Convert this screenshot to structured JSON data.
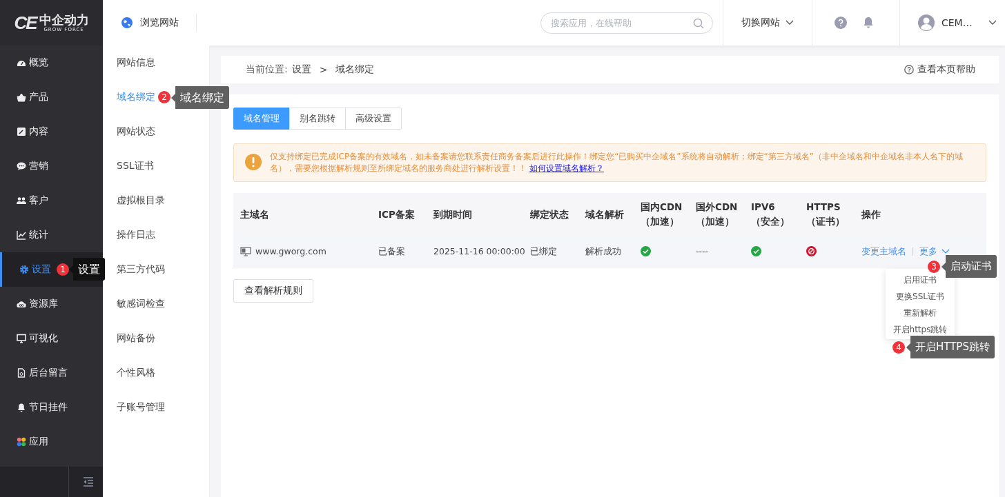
{
  "logo": {
    "mark": "CE",
    "name": "中企动力",
    "tagline": "GROW FORCE"
  },
  "header": {
    "browse_site": "浏览网站",
    "search": {
      "placeholder": "搜索应用，在线帮助"
    },
    "switch_site": "切换网站",
    "user": "CEM…"
  },
  "sidebar": {
    "items": [
      {
        "label": "概览",
        "selected": false
      },
      {
        "label": "产品",
        "selected": false
      },
      {
        "label": "内容",
        "selected": false
      },
      {
        "label": "营销",
        "selected": false
      },
      {
        "label": "客户",
        "selected": false
      },
      {
        "label": "统计",
        "selected": false
      },
      {
        "label": "设置",
        "selected": true,
        "annotation": {
          "number": "1",
          "label": "设置"
        }
      },
      {
        "label": "资源库",
        "selected": false
      },
      {
        "label": "可视化",
        "selected": false
      },
      {
        "label": "后台留言",
        "selected": false
      },
      {
        "label": "节日挂件",
        "selected": false
      },
      {
        "label": "应用",
        "selected": false
      }
    ]
  },
  "submenu": {
    "items": [
      {
        "label": "网站信息",
        "selected": false
      },
      {
        "label": "域名绑定",
        "selected": true,
        "annotation": {
          "number": "2",
          "label": "域名绑定"
        }
      },
      {
        "label": "网站状态",
        "selected": false
      },
      {
        "label": "SSL证书",
        "selected": false
      },
      {
        "label": "虚拟根目录",
        "selected": false
      },
      {
        "label": "操作日志",
        "selected": false
      },
      {
        "label": "第三方代码",
        "selected": false
      },
      {
        "label": "敏感词检查",
        "selected": false
      },
      {
        "label": "网站备份",
        "selected": false
      },
      {
        "label": "个性风格",
        "selected": false
      },
      {
        "label": "子账号管理",
        "selected": false
      }
    ]
  },
  "breadcrumb": {
    "prefix": "当前位置:",
    "items": [
      "设置",
      "域名绑定"
    ],
    "separator": ">",
    "help": "查看本页帮助"
  },
  "tabs": [
    {
      "label": "域名管理",
      "selected": true
    },
    {
      "label": "别名跳转",
      "selected": false
    },
    {
      "label": "高级设置",
      "selected": false
    }
  ],
  "alert": {
    "text": "仅支持绑定已完成ICP备案的有效域名，如未备案请您联系责任商务备案后进行此操作！绑定您“已购买中企域名”系统将自动解析；绑定“第三方域名”（非中企域名和中企域名非本人名下的域名），需要您根据解析规则至所绑定域名的服务商处进行解析设置！！",
    "link": "如何设置域名解析？"
  },
  "table": {
    "columns": [
      "主域名",
      "ICP备案",
      "到期时间",
      "绑定状态",
      "域名解析",
      "国内CDN（加速）",
      "国外CDN（加速）",
      "IPV6（安全）",
      "HTTPS（证书）",
      "操作"
    ],
    "rows": [
      {
        "cells": [
          {
            "kind": "domain",
            "text": "www.gworg.com"
          },
          {
            "kind": "text",
            "text": "已备案"
          },
          {
            "kind": "date",
            "text": "2025-11-16 00:00:00"
          },
          {
            "kind": "text",
            "text": "已绑定"
          },
          {
            "kind": "text",
            "text": "解析成功"
          },
          {
            "kind": "check"
          },
          {
            "kind": "text",
            "text": "----"
          },
          {
            "kind": "check"
          },
          {
            "kind": "blocked"
          },
          {
            "kind": "actions",
            "links": [
              "变更主域名",
              "更多"
            ]
          }
        ]
      }
    ]
  },
  "rules_button": "查看解析规则",
  "dropdown": {
    "items": [
      {
        "label": "启用证书",
        "annotation": {
          "number": "3",
          "label": "启动证书"
        }
      },
      {
        "label": "更换SSL证书"
      },
      {
        "label": "重新解析"
      },
      {
        "label": "开启https跳转",
        "annotation": {
          "number": "4",
          "label": "开启HTTPS跳转"
        }
      }
    ]
  }
}
